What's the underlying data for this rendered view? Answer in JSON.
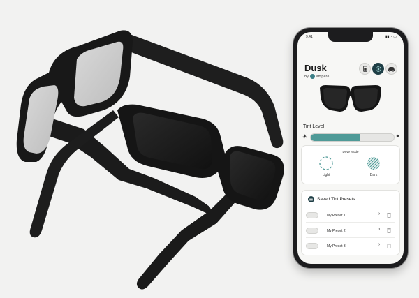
{
  "app": {
    "status_time": "9:41",
    "title": "Dusk",
    "by_prefix": "By",
    "brand_name": "ampere",
    "tint_level_label": "Tint Level",
    "tint_level_fraction": 0.6,
    "drive_mode": {
      "label": "Drive Mode",
      "light_label": "Light",
      "dark_label": "Dark"
    },
    "presets": {
      "title": "Saved Tint Presets",
      "items": [
        {
          "name": "My Preset 1"
        },
        {
          "name": "My Preset 2"
        },
        {
          "name": "My Preset 3"
        }
      ]
    }
  },
  "colors": {
    "accent_teal": "#4f9a97",
    "active_button": "#1f3f46",
    "phone_frame": "#1c1c1e",
    "background": "#f2f2f1"
  },
  "icons": [
    "battery-icon",
    "glasses-settings-icon",
    "car-icon",
    "sun-icon",
    "presets-list-icon",
    "chevron-right-icon",
    "trash-icon"
  ]
}
